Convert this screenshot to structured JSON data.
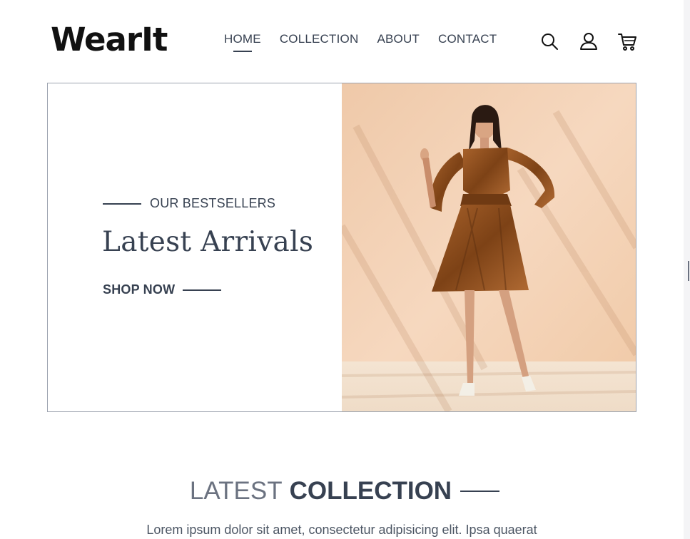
{
  "brand": {
    "logo_text": "WearIt"
  },
  "nav": {
    "items": [
      {
        "label": "HOME",
        "active": true
      },
      {
        "label": "COLLECTION",
        "active": false
      },
      {
        "label": "ABOUT",
        "active": false
      },
      {
        "label": "CONTACT",
        "active": false
      }
    ]
  },
  "header_icons": [
    "search-icon",
    "user-icon",
    "cart-icon"
  ],
  "hero": {
    "eyebrow": "OUR BESTSELLERS",
    "title": "Latest Arrivals",
    "cta": "SHOP NOW",
    "image": "woman-in-bronze-satin-dress"
  },
  "latest": {
    "title_light": "LATEST",
    "title_bold": "COLLECTION",
    "description": "Lorem ipsum dolor sit amet, consectetur adipisicing elit. Ipsa quaerat"
  },
  "colors": {
    "text": "#374151",
    "muted": "#6b7280",
    "hero_background": "#f3d2b5",
    "dress": "#8a4a1c"
  }
}
